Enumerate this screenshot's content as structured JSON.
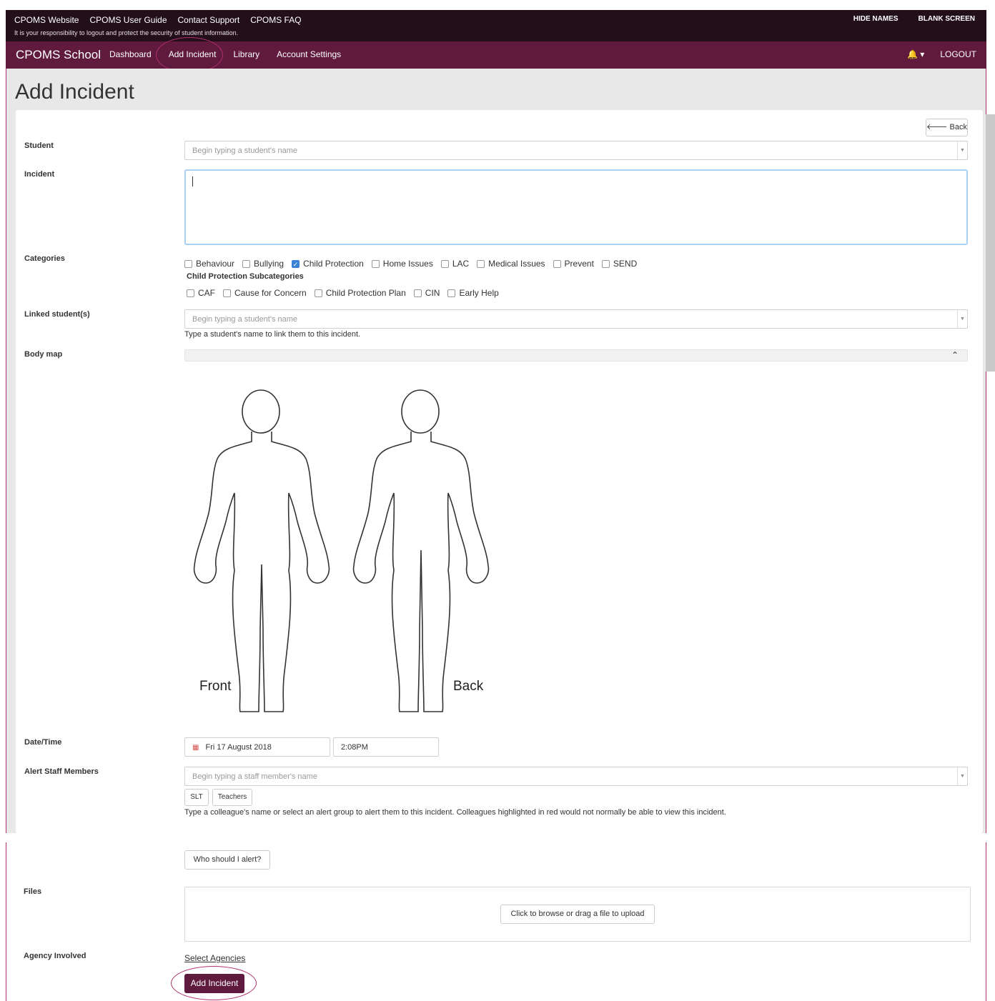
{
  "topbar": {
    "links": [
      "CPOMS Website",
      "CPOMS User Guide",
      "Contact Support",
      "CPOMS FAQ"
    ],
    "notice": "It is your responsibility to logout and protect the security of student information.",
    "hide_names": "HIDE NAMES",
    "blank_screen": "BLANK SCREEN"
  },
  "navbar": {
    "brand": "CPOMS School",
    "items": [
      "Dashboard",
      "Add Incident",
      "Library",
      "Account Settings"
    ],
    "bell": "🔔 ▾",
    "logout": "LOGOUT"
  },
  "page": {
    "title": "Add Incident",
    "back_label": "🡐 Back"
  },
  "form": {
    "student": {
      "label": "Student",
      "placeholder": "Begin typing a student's name"
    },
    "incident": {
      "label": "Incident"
    },
    "categories": {
      "label": "Categories",
      "items": [
        {
          "name": "Behaviour",
          "checked": false
        },
        {
          "name": "Bullying",
          "checked": false
        },
        {
          "name": "Child Protection",
          "checked": true
        },
        {
          "name": "Home Issues",
          "checked": false
        },
        {
          "name": "LAC",
          "checked": false
        },
        {
          "name": "Medical Issues",
          "checked": false
        },
        {
          "name": "Prevent",
          "checked": false
        },
        {
          "name": "SEND",
          "checked": false
        }
      ],
      "sub_title": "Child Protection Subcategories",
      "sub_items": [
        "CAF",
        "Cause for Concern",
        "Child Protection Plan",
        "CIN",
        "Early Help"
      ]
    },
    "linked": {
      "label": "Linked student(s)",
      "placeholder": "Begin typing a student's name",
      "help": "Type a student's name to link them to this incident."
    },
    "body_map": {
      "label": "Body map",
      "front": "Front",
      "back": "Back"
    },
    "datetime": {
      "label": "Date/Time",
      "date": "Fri 17 August 2018",
      "time": "2:08PM"
    },
    "alert": {
      "label": "Alert Staff Members",
      "placeholder": "Begin typing a staff member's name",
      "groups": [
        "SLT",
        "Teachers"
      ],
      "help": "Type a colleague's name or select an alert group to alert them to this incident. Colleagues highlighted in red would not normally be able to view this incident.",
      "who_button": "Who should I alert?"
    },
    "files": {
      "label": "Files",
      "upload_button": "Click to browse or drag a file to upload"
    },
    "agency": {
      "label": "Agency Involved",
      "link": "Select Agencies"
    },
    "submit": "Add Incident"
  },
  "colors": {
    "topbar": "#220f1a",
    "navbar": "#5f1a3e",
    "highlight": "#b0306c",
    "checkbox": "#3b82d6"
  }
}
